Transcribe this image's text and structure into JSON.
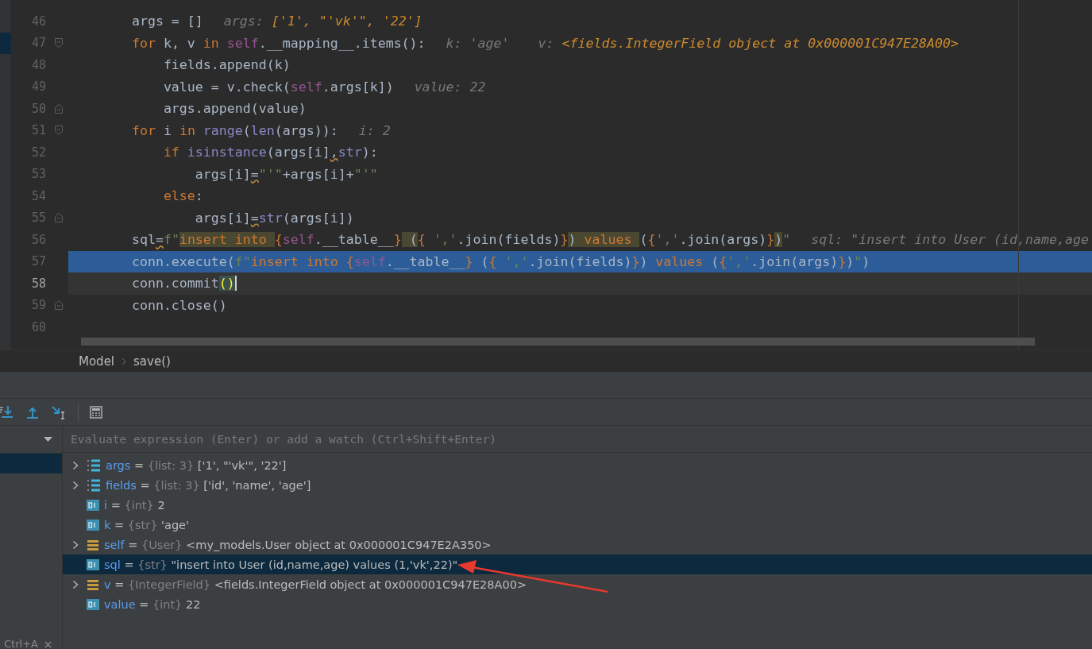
{
  "editor": {
    "lines": [
      {
        "number": "46",
        "fold_start": false,
        "fold_end": false,
        "execution_point": false,
        "current": false,
        "marked": false,
        "tokens": [
          {
            "t": "        args = []",
            "kind": "plain"
          }
        ],
        "hints": [
          {
            "t": "args:",
            "kind": "name"
          },
          {
            "t": "['1', \"'vk'\", '22']",
            "kind": "value"
          }
        ]
      },
      {
        "number": "47",
        "fold_start": true,
        "fold_end": false,
        "execution_point": false,
        "current": false,
        "marked": true,
        "tokens": [
          {
            "t": "        for",
            "kind": "keyword"
          },
          {
            "t": " k, v ",
            "kind": "plain"
          },
          {
            "t": "in",
            "kind": "keyword"
          },
          {
            "t": " self",
            "kind": "self"
          },
          {
            "t": ".__mapping__.items():",
            "kind": "plain"
          }
        ],
        "hints": [
          {
            "t": "k:",
            "kind": "name"
          },
          {
            "t": "'age'",
            "kind": "dim"
          },
          {
            "t": "v:",
            "kind": "name"
          },
          {
            "t": "<fields.IntegerField object at 0x000001C947E28A00>",
            "kind": "value"
          }
        ]
      },
      {
        "number": "48",
        "fold_start": false,
        "fold_end": false,
        "execution_point": false,
        "current": false,
        "marked": false,
        "tokens": [
          {
            "t": "            fields.append(k)",
            "kind": "plain"
          }
        ]
      },
      {
        "number": "49",
        "fold_start": false,
        "fold_end": false,
        "execution_point": false,
        "current": false,
        "marked": false,
        "tokens": [
          {
            "t": "            value = v.check(",
            "kind": "plain"
          },
          {
            "t": "self",
            "kind": "self"
          },
          {
            "t": ".args[k])",
            "kind": "plain"
          }
        ],
        "hints": [
          {
            "t": "value:",
            "kind": "name"
          },
          {
            "t": "22",
            "kind": "dim"
          }
        ]
      },
      {
        "number": "50",
        "fold_start": false,
        "fold_end": true,
        "execution_point": false,
        "current": false,
        "marked": false,
        "tokens": [
          {
            "t": "            args.append(value)",
            "kind": "plain"
          }
        ]
      },
      {
        "number": "51",
        "fold_start": true,
        "fold_end": false,
        "execution_point": false,
        "current": false,
        "marked": false,
        "tokens": [
          {
            "t": "        for",
            "kind": "keyword"
          },
          {
            "t": " i ",
            "kind": "plain"
          },
          {
            "t": "in",
            "kind": "keyword"
          },
          {
            "t": " range",
            "kind": "builtin"
          },
          {
            "t": "(",
            "kind": "plain"
          },
          {
            "t": "len",
            "kind": "builtin"
          },
          {
            "t": "(args)):",
            "kind": "plain"
          }
        ],
        "hints": [
          {
            "t": "i:",
            "kind": "name"
          },
          {
            "t": "2",
            "kind": "dim"
          }
        ]
      },
      {
        "number": "52",
        "fold_start": false,
        "fold_end": false,
        "execution_point": false,
        "current": false,
        "marked": false,
        "tokens": [
          {
            "t": "            if",
            "kind": "keyword"
          },
          {
            "t": " isinstance",
            "kind": "builtin"
          },
          {
            "t": "(args[i]",
            "kind": "plain"
          },
          {
            "t": ",",
            "kind": "warning"
          },
          {
            "t": "str",
            "kind": "builtin"
          },
          {
            "t": "):",
            "kind": "plain"
          }
        ]
      },
      {
        "number": "53",
        "fold_start": false,
        "fold_end": false,
        "execution_point": false,
        "current": false,
        "marked": false,
        "tokens": [
          {
            "t": "                args[i]",
            "kind": "plain"
          },
          {
            "t": "=",
            "kind": "warning"
          },
          {
            "t": "\"'\"",
            "kind": "string"
          },
          {
            "t": "+args[i]+",
            "kind": "plain"
          },
          {
            "t": "\"'\"",
            "kind": "string"
          }
        ]
      },
      {
        "number": "54",
        "fold_start": false,
        "fold_end": false,
        "execution_point": false,
        "current": false,
        "marked": false,
        "tokens": [
          {
            "t": "            else",
            "kind": "keyword"
          },
          {
            "t": ":",
            "kind": "plain"
          }
        ]
      },
      {
        "number": "55",
        "fold_start": false,
        "fold_end": true,
        "execution_point": false,
        "current": false,
        "marked": false,
        "tokens": [
          {
            "t": "                args[i]",
            "kind": "plain"
          },
          {
            "t": "=",
            "kind": "warning"
          },
          {
            "t": "str",
            "kind": "builtin"
          },
          {
            "t": "(args[i])",
            "kind": "plain"
          }
        ]
      },
      {
        "number": "56",
        "fold_start": false,
        "fold_end": false,
        "execution_point": false,
        "current": false,
        "marked": false,
        "tokens": [
          {
            "t": "        sql",
            "kind": "plain"
          },
          {
            "t": "=",
            "kind": "warning"
          },
          {
            "t": "f\"",
            "kind": "string"
          },
          {
            "t": "insert into ",
            "kind": "fstring-match"
          },
          {
            "t": "{",
            "kind": "brace"
          },
          {
            "t": "self",
            "kind": "self"
          },
          {
            "t": ".__table__",
            "kind": "plain"
          },
          {
            "t": "}",
            "kind": "brace"
          },
          {
            "t": " (",
            "kind": "plain-match"
          },
          {
            "t": "{",
            "kind": "brace"
          },
          {
            "t": " ','",
            "kind": "string"
          },
          {
            "t": ".join(fields)",
            "kind": "plain"
          },
          {
            "t": "}",
            "kind": "brace"
          },
          {
            "t": ")",
            "kind": "plain-match"
          },
          {
            "t": " values ",
            "kind": "fstring-match"
          },
          {
            "t": "(",
            "kind": "plain"
          },
          {
            "t": "{",
            "kind": "brace"
          },
          {
            "t": "','",
            "kind": "string"
          },
          {
            "t": ".join(args)",
            "kind": "plain"
          },
          {
            "t": "}",
            "kind": "brace"
          },
          {
            "t": ")",
            "kind": "plain-match"
          },
          {
            "t": "\"",
            "kind": "string"
          }
        ],
        "hints": [
          {
            "t": "sql:",
            "kind": "name"
          },
          {
            "t": "\"insert into User (id,name,age",
            "kind": "dim"
          }
        ]
      },
      {
        "number": "57",
        "fold_start": false,
        "fold_end": false,
        "execution_point": true,
        "current": false,
        "marked": false,
        "tokens": [
          {
            "t": "        conn.execute(",
            "kind": "plain"
          },
          {
            "t": "f\"",
            "kind": "string"
          },
          {
            "t": "insert into ",
            "kind": "fstring"
          },
          {
            "t": "{",
            "kind": "brace"
          },
          {
            "t": "self",
            "kind": "self"
          },
          {
            "t": ".__table__",
            "kind": "plain"
          },
          {
            "t": "}",
            "kind": "brace"
          },
          {
            "t": " (",
            "kind": "plain"
          },
          {
            "t": "{",
            "kind": "brace"
          },
          {
            "t": " ','",
            "kind": "string"
          },
          {
            "t": ".join(fields)",
            "kind": "plain"
          },
          {
            "t": "}",
            "kind": "brace"
          },
          {
            "t": ") ",
            "kind": "plain"
          },
          {
            "t": "values ",
            "kind": "fstring"
          },
          {
            "t": "(",
            "kind": "plain"
          },
          {
            "t": "{",
            "kind": "brace"
          },
          {
            "t": "','",
            "kind": "string"
          },
          {
            "t": ".join(args)",
            "kind": "plain"
          },
          {
            "t": "}",
            "kind": "brace"
          },
          {
            "t": ")",
            "kind": "plain"
          },
          {
            "t": "\"",
            "kind": "string"
          },
          {
            "t": ")",
            "kind": "plain"
          }
        ]
      },
      {
        "number": "58",
        "fold_start": false,
        "fold_end": false,
        "execution_point": false,
        "current": true,
        "marked": false,
        "tokens": [
          {
            "t": "        conn.commit",
            "kind": "plain"
          },
          {
            "t": "()",
            "kind": "paren-match"
          }
        ]
      },
      {
        "number": "59",
        "fold_start": false,
        "fold_end": true,
        "execution_point": false,
        "current": false,
        "marked": false,
        "tokens": [
          {
            "t": "        conn.close()",
            "kind": "plain"
          }
        ]
      },
      {
        "number": "60",
        "fold_start": false,
        "fold_end": false,
        "execution_point": false,
        "current": false,
        "marked": false
      }
    ]
  },
  "breadcrumbs": [
    "Model",
    "save()"
  ],
  "debugger": {
    "evaluate": {
      "placeholder": "Evaluate expression (Enter) or add a watch (Ctrl+Shift+Enter)"
    },
    "frames": [
      {
        "selected": true
      }
    ],
    "variables": [
      {
        "kind": "list",
        "expandable": true,
        "selected": false,
        "name": "args",
        "operator": "=",
        "type": "{list: 3}",
        "value": "['1', \"'vk'\", '22']"
      },
      {
        "kind": "list",
        "expandable": true,
        "selected": false,
        "name": "fields",
        "operator": "=",
        "type": "{list: 3}",
        "value": "['id', 'name', 'age']"
      },
      {
        "kind": "primitive",
        "expandable": false,
        "selected": false,
        "name": "i",
        "operator": "=",
        "type": "{int}",
        "value": "2"
      },
      {
        "kind": "primitive",
        "expandable": false,
        "selected": false,
        "name": "k",
        "operator": "=",
        "type": "{str}",
        "value": "'age'"
      },
      {
        "kind": "object",
        "expandable": true,
        "selected": false,
        "name": "self",
        "operator": "=",
        "type": "{User}",
        "value": "<my_models.User object at 0x000001C947E2A350>"
      },
      {
        "kind": "primitive",
        "expandable": false,
        "selected": true,
        "name": "sql",
        "operator": "=",
        "type": "{str}",
        "value": "\"insert into User (id,name,age) values (1,'vk',22)\""
      },
      {
        "kind": "object",
        "expandable": true,
        "selected": false,
        "name": "v",
        "operator": "=",
        "type": "{IntegerField}",
        "value": "<fields.IntegerField object at 0x000001C947E28A00>"
      },
      {
        "kind": "primitive",
        "expandable": false,
        "selected": false,
        "name": "value",
        "operator": "=",
        "type": "{int}",
        "value": "22"
      }
    ],
    "shortcut": {
      "label": "Ctrl+A"
    }
  }
}
